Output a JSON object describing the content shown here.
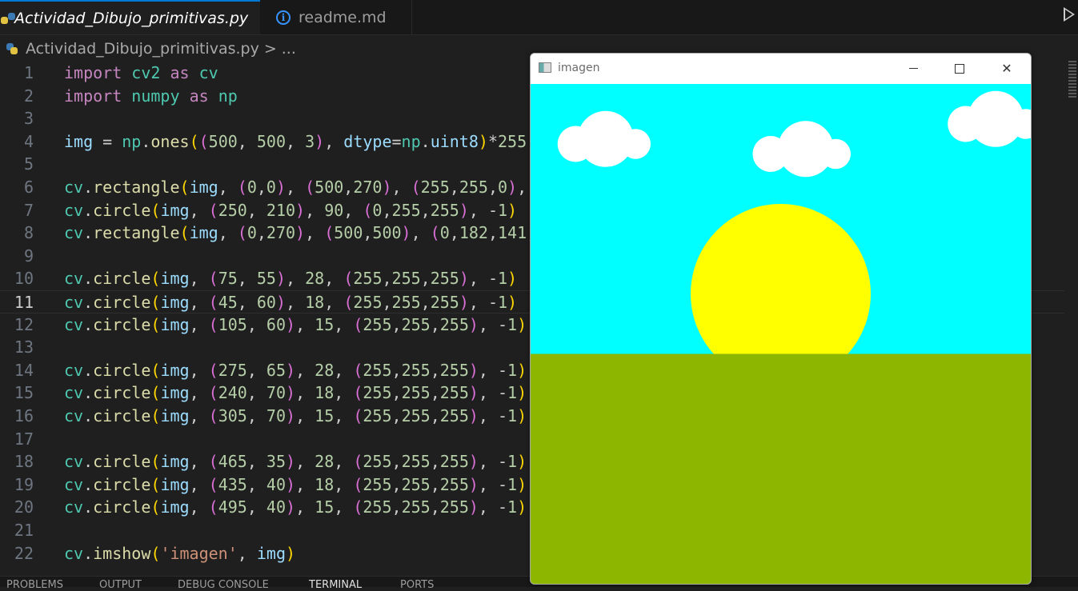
{
  "tabs": [
    {
      "label": "Actividad_Dibujo_primitivas.py",
      "icon": "python-file-icon",
      "active": true
    },
    {
      "label": "readme.md",
      "icon": "info-icon",
      "active": false
    }
  ],
  "breadcrumb": {
    "file": "Actividad_Dibujo_primitivas.py",
    "separator": ">",
    "ellipsis": "..."
  },
  "editor": {
    "current_line": 11,
    "line_numbers": [
      "1",
      "2",
      "3",
      "4",
      "5",
      "6",
      "7",
      "8",
      "9",
      "10",
      "11",
      "12",
      "13",
      "14",
      "15",
      "16",
      "17",
      "18",
      "19",
      "20",
      "21",
      "22"
    ]
  },
  "panel_tabs": [
    "PROBLEMS",
    "OUTPUT",
    "DEBUG CONSOLE",
    "TERMINAL",
    "PORTS"
  ],
  "image_window": {
    "title": "imagen",
    "canvas_size": [
      500,
      500
    ],
    "sky_color": "#00ffff",
    "sun_color": "#ffff00",
    "ground_color": "#8db600",
    "cloud_color": "#ffffff",
    "controls": [
      "minimize-icon",
      "maximize-icon",
      "close-icon"
    ]
  },
  "colors": {
    "accent": "#0078d4",
    "editor_bg": "#1f1f1f",
    "tabbar_bg": "#181818"
  }
}
